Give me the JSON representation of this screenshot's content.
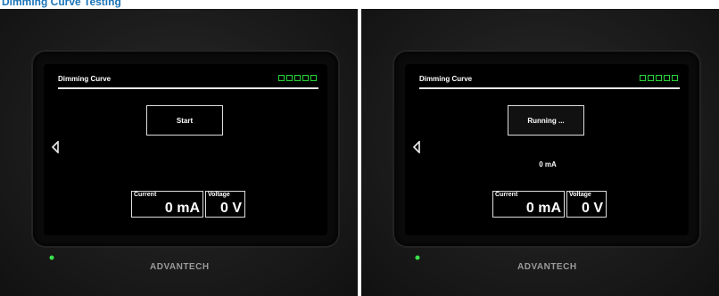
{
  "caption": "Dimming Curve Testing",
  "colors": {
    "accent_green": "#27d63a",
    "caption_blue": "#1a74b8"
  },
  "panels": [
    {
      "screen_title": "Dimming Curve",
      "status_lights": 5,
      "start_label": "Start",
      "current_label": "Current",
      "current_value": "0 mA",
      "voltage_label": "Voltage",
      "voltage_value": "0 V",
      "brand": "ADVANTECH",
      "back_icon": "back-arrow-icon",
      "power_icon": "power-led-icon"
    },
    {
      "screen_title": "Dimming Curve",
      "status_lights": 5,
      "running_label": "Running ...",
      "readout": "0 mA",
      "current_label": "Current",
      "current_value": "0 mA",
      "voltage_label": "Voltage",
      "voltage_value": "0 V",
      "brand": "ADVANTECH",
      "back_icon": "back-arrow-icon",
      "power_icon": "power-led-icon"
    }
  ]
}
